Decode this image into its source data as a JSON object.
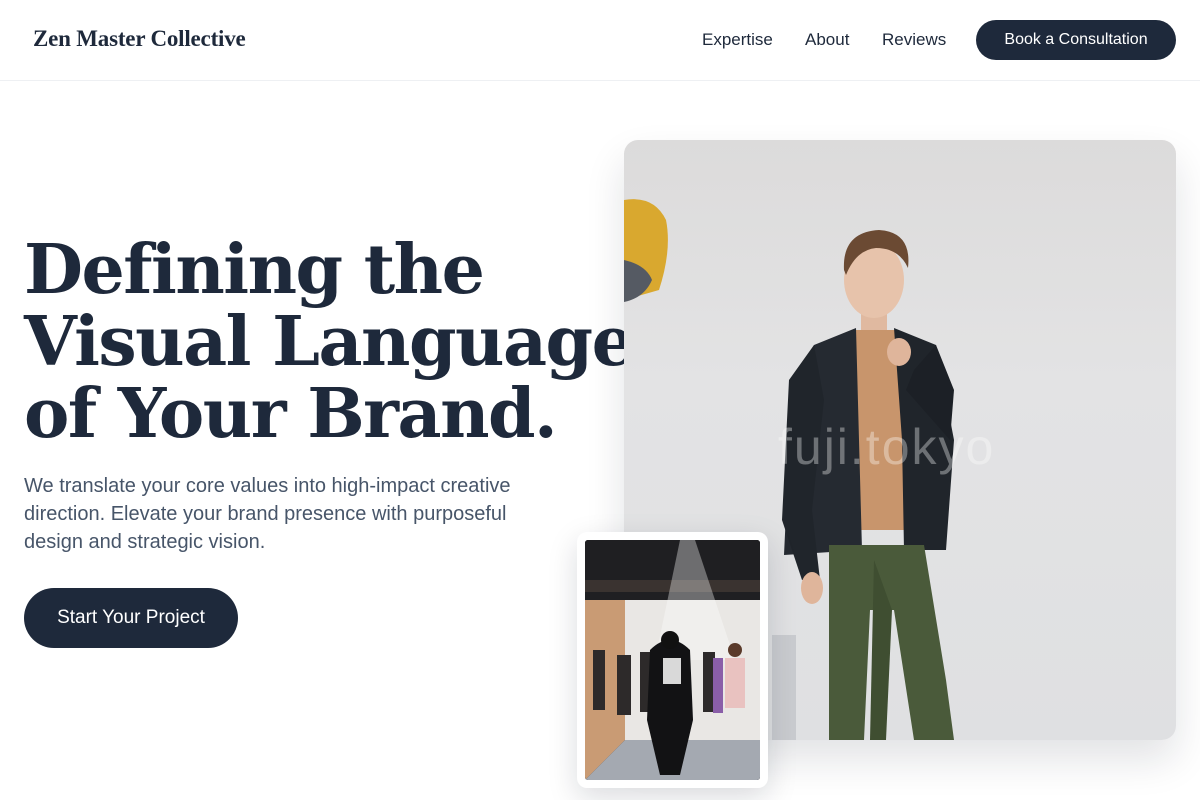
{
  "header": {
    "logo": "Zen Master Collective",
    "nav": [
      "Expertise",
      "About",
      "Reviews"
    ],
    "cta": "Book a Consultation"
  },
  "hero": {
    "title_lines": [
      "Defining the",
      "Visual Language",
      "of Your Brand."
    ],
    "subtitle": "We translate your core values into high-impact creative direction. Elevate your brand presence with purposeful design and strategic vision.",
    "cta": "Start Your Project"
  },
  "images": {
    "main_photo": "fashion-model-photo",
    "watermark": "fuji.tokyo",
    "event_photo": "fashion-show-backstage-photo"
  },
  "colors": {
    "primary": "#1e293b",
    "text_muted": "#475569",
    "background": "#ffffff"
  }
}
